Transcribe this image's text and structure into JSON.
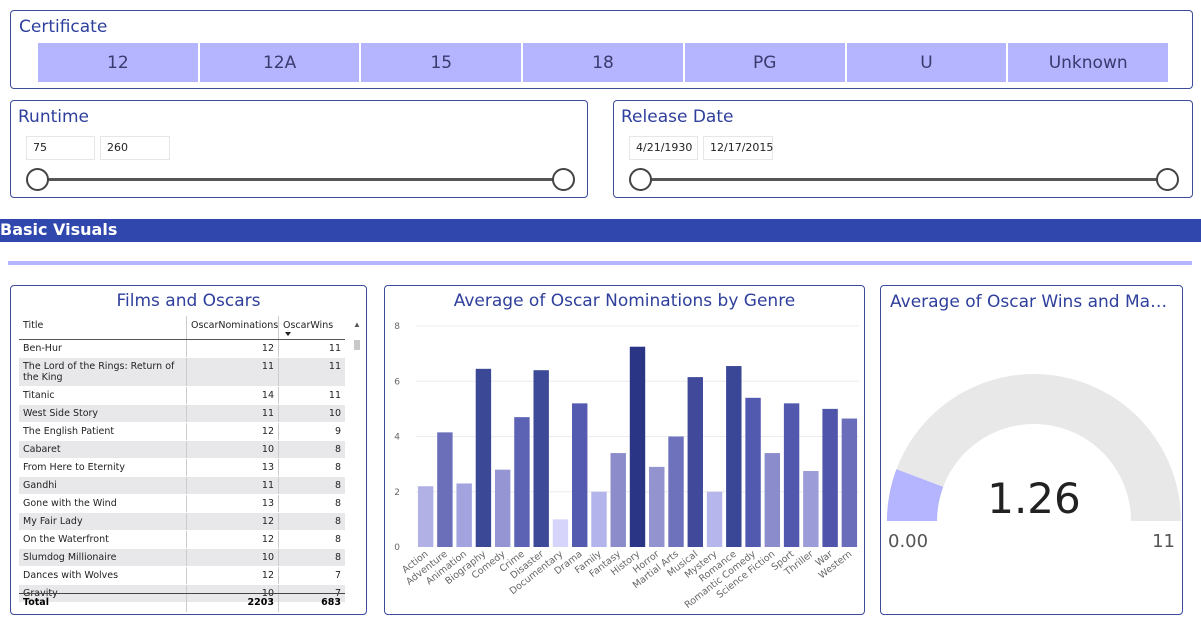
{
  "certificate": {
    "title": "Certificate",
    "options": [
      "12",
      "12A",
      "15",
      "18",
      "PG",
      "U",
      "Unknown"
    ]
  },
  "runtime": {
    "title": "Runtime",
    "min_value": "75",
    "max_value": "260"
  },
  "release_date": {
    "title": "Release Date",
    "min_value": "4/21/1930",
    "max_value": "12/17/2015"
  },
  "section": {
    "title": "Basic Visuals"
  },
  "films_table": {
    "title": "Films and Oscars",
    "columns": [
      "Title",
      "OscarNominations",
      "OscarWins"
    ],
    "rows": [
      [
        "Ben-Hur",
        "12",
        "11"
      ],
      [
        "The Lord of the Rings: Return of the King",
        "11",
        "11"
      ],
      [
        "Titanic",
        "14",
        "11"
      ],
      [
        "West Side Story",
        "11",
        "10"
      ],
      [
        "The English Patient",
        "12",
        "9"
      ],
      [
        "Cabaret",
        "10",
        "8"
      ],
      [
        "From Here to Eternity",
        "13",
        "8"
      ],
      [
        "Gandhi",
        "11",
        "8"
      ],
      [
        "Gone with the Wind",
        "13",
        "8"
      ],
      [
        "My Fair Lady",
        "12",
        "8"
      ],
      [
        "On the Waterfront",
        "12",
        "8"
      ],
      [
        "Slumdog Millionaire",
        "10",
        "8"
      ],
      [
        "Dances with Wolves",
        "12",
        "7"
      ],
      [
        "Gravity",
        "10",
        "7"
      ]
    ],
    "total": [
      "Total",
      "2203",
      "683"
    ]
  },
  "chart_data": [
    {
      "type": "bar",
      "title": "Average of Oscar Nominations by Genre",
      "xlabel": "",
      "ylabel": "",
      "ylim": [
        0,
        8
      ],
      "yticks": [
        "0",
        "2",
        "4",
        "6",
        "8"
      ],
      "grid": true,
      "categories": [
        "Action",
        "Adventure",
        "Animation",
        "Biography",
        "Comedy",
        "Crime",
        "Disaster",
        "Documentary",
        "Drama",
        "Family",
        "Fantasy",
        "History",
        "Horror",
        "Martial Arts",
        "Musical",
        "Mystery",
        "Romance",
        "Romantic Comedy",
        "Science Fiction",
        "Sport",
        "Thriller",
        "War",
        "Western"
      ],
      "values": [
        2.2,
        4.15,
        2.3,
        6.45,
        2.8,
        4.7,
        6.4,
        1.0,
        5.2,
        2.0,
        3.4,
        7.25,
        2.9,
        4.0,
        6.15,
        2.0,
        6.55,
        5.4,
        3.4,
        5.2,
        2.75,
        5.0,
        4.65
      ],
      "colors": [
        "#b1b1e6",
        "#6b6fba",
        "#a3a3df",
        "#3a4896",
        "#9595d3",
        "#5c62b4",
        "#3c4a98",
        "#d6d4fb",
        "#535ab0",
        "#b4b4ec",
        "#8c8ccb",
        "#2a3585",
        "#9393cf",
        "#6e72bc",
        "#41499a",
        "#b6b6ec",
        "#3a4796",
        "#525ab0",
        "#8b8ccb",
        "#5158ad",
        "#9c9cd8",
        "#4e55aa",
        "#6a6eba"
      ]
    },
    {
      "type": "gauge",
      "title": "Average of Oscar Wins and Max of ...",
      "value": 1.26,
      "value_label": "1.26",
      "min": 0,
      "max": 11,
      "min_label": "0.00",
      "max_label": "11",
      "fill_color": "#b4b4ff",
      "track_color": "#e8e8e8"
    }
  ],
  "colors": {
    "accent": "#3047ae",
    "slicer_fill": "#b4b4ff",
    "border": "#3c4b9a"
  }
}
